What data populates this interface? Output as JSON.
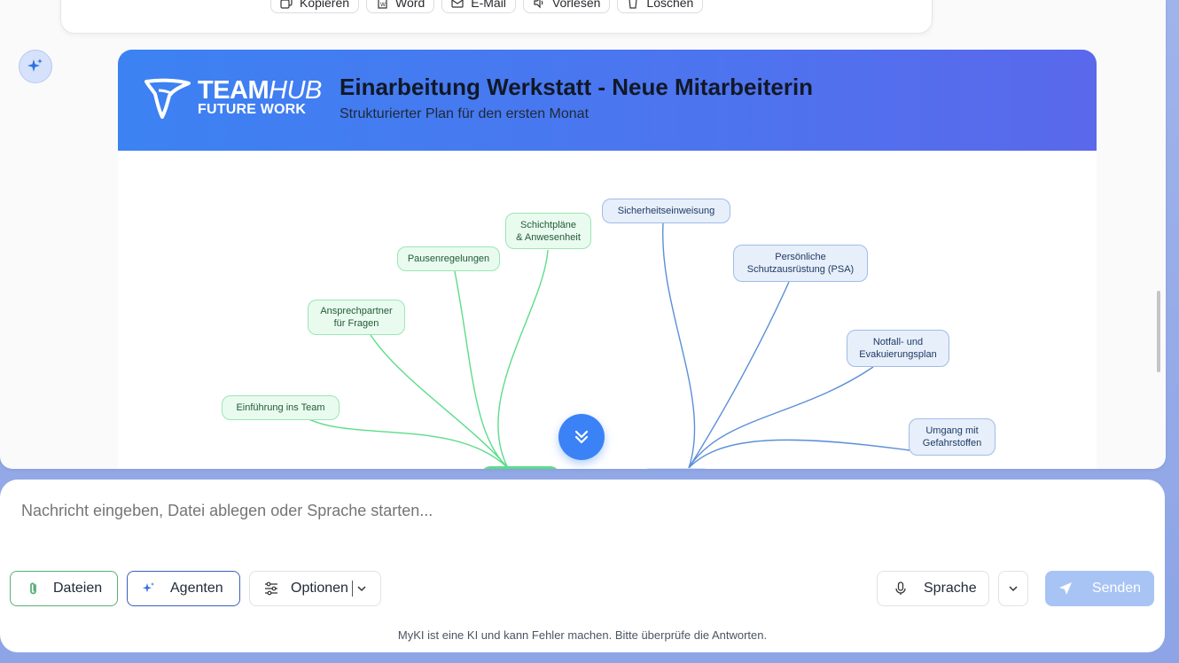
{
  "message_actions": [
    {
      "label": "Kopieren",
      "icon": "copy-icon"
    },
    {
      "label": "Word",
      "icon": "word-doc-icon"
    },
    {
      "label": "E-Mail",
      "icon": "email-icon"
    },
    {
      "label": "Vorlesen",
      "icon": "speaker-icon"
    },
    {
      "label": "Löschen",
      "icon": "trash-icon"
    }
  ],
  "card": {
    "logo_main_bold": "TEAM",
    "logo_main_light": "HUB",
    "logo_sub": "FUTURE WORK",
    "title": "Einarbeitung Werkstatt - Neue Mitarbeiterin",
    "subtitle": "Strukturierter Plan für den ersten Monat"
  },
  "mindmap": {
    "green_nodes": [
      "Einführung ins Team",
      "Ansprechpartner\nfür Fragen",
      "Pausenregelungen",
      "Schichtpläne\n& Anwesenheit"
    ],
    "blue_nodes": [
      "Sicherheitseinweisung",
      "Persönliche\nSchutzausrüstung (PSA)",
      "Notfall- und\nEvakuierungsplan",
      "Umgang mit\nGefahrstoffen"
    ],
    "colors": {
      "green": "#5ddc8a",
      "blue": "#5b8fd8"
    }
  },
  "composer": {
    "placeholder": "Nachricht eingeben, Datei ablegen oder Sprache starten...",
    "files_label": "Dateien",
    "agents_label": "Agenten",
    "options_label": "Optionen",
    "voice_label": "Sprache",
    "send_label": "Senden",
    "disclaimer": "MyKI ist eine KI und kann Fehler machen. Bitte überprüfe die Antworten."
  }
}
